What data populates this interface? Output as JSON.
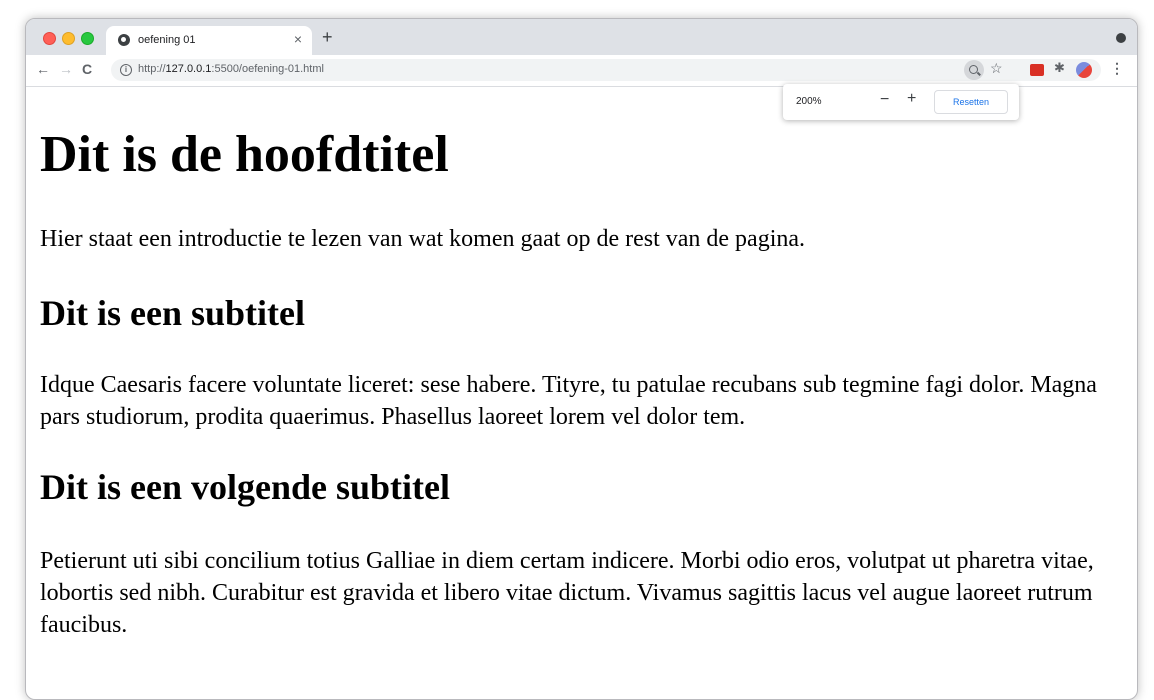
{
  "browser": {
    "tab": {
      "title": "oefening 01",
      "close_icon": "×"
    },
    "new_tab_icon": "+",
    "nav": {
      "back": "←",
      "forward": "→",
      "reload": "C"
    },
    "address": {
      "scheme": "http://",
      "host": "127.0.0.1",
      "path": ":5500/oefening-01.html"
    },
    "icons": {
      "star": "☆",
      "puzzle": "✱",
      "menu": "⋮"
    },
    "zoom_popup": {
      "level": "200%",
      "minus": "−",
      "plus": "+",
      "reset": "Resetten"
    }
  },
  "page": {
    "title": "Dit is de hoofdtitel",
    "intro": "Hier staat een introductie te lezen van wat komen gaat op de rest van de pagina.",
    "sections": [
      {
        "heading": "Dit is een subtitel",
        "body": "Idque Caesaris facere voluntate liceret: sese habere. Tityre, tu patulae recubans sub tegmine fagi dolor. Magna pars studiorum, prodita quaerimus. Phasellus laoreet lorem vel dolor tem."
      },
      {
        "heading": "Dit is een volgende subtitel",
        "body": "Petierunt uti sibi concilium totius Galliae in diem certam indicere. Morbi odio eros, volutpat ut pharetra vitae, lobortis sed nibh. Curabitur est gravida et libero vitae dictum. Vivamus sagittis lacus vel augue laoreet rutrum faucibus."
      }
    ]
  },
  "colors": {
    "tabbar": "#dee1e6",
    "accent": "#1a73e8",
    "close": "#ff5f57",
    "minimize": "#febc2e",
    "maximize": "#28c840"
  }
}
